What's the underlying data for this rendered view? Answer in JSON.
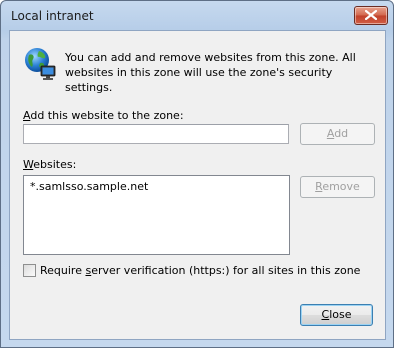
{
  "window": {
    "title": "Local intranet"
  },
  "intro_text": "You can add and remove websites from this zone. All websites in this zone will use the zone's security settings.",
  "add_section": {
    "label_key": "A",
    "label_rest": "dd this website to the zone:",
    "input_value": "",
    "add_button_key": "A",
    "add_button_rest": "dd"
  },
  "websites_section": {
    "label_key": "W",
    "label_rest": "ebsites:",
    "items": [
      "*.samlsso.sample.net"
    ],
    "remove_button_key": "R",
    "remove_button_rest": "emove"
  },
  "verification": {
    "label_pre": "Require ",
    "label_key": "s",
    "label_post": "erver verification (https:) for all sites in this zone",
    "checked": false
  },
  "close_button_key": "C",
  "close_button_rest": "lose",
  "icons": {
    "zone": "globe-network-icon",
    "title_close": "close-icon"
  }
}
